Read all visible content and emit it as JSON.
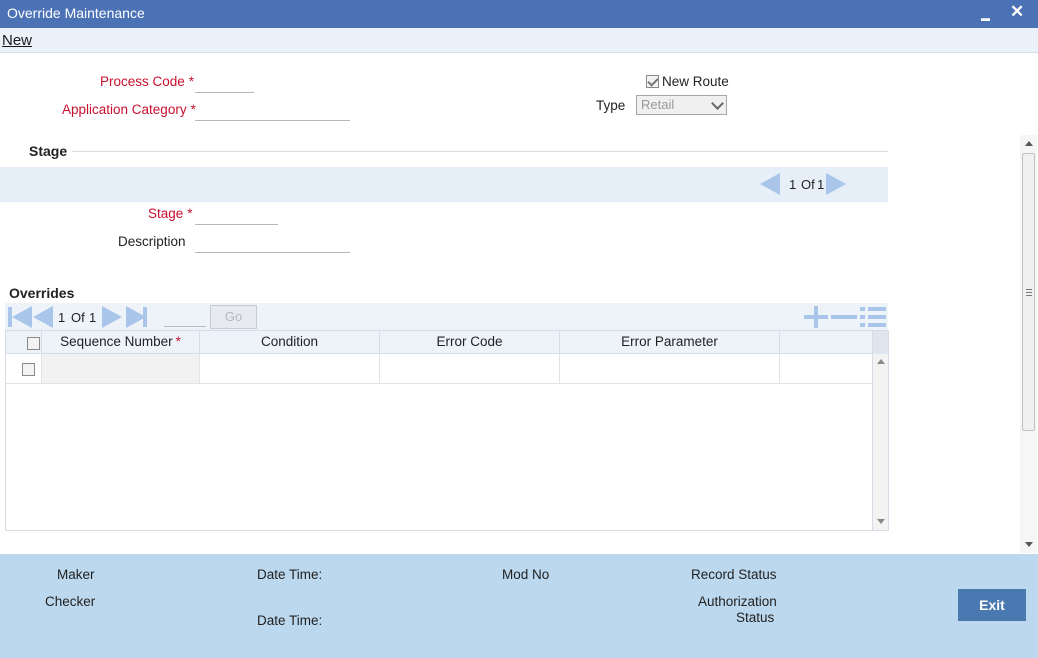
{
  "window": {
    "title": "Override Maintenance",
    "minimize_glyph": "▬",
    "close_glyph": "✕"
  },
  "menu": {
    "new_label": "New"
  },
  "form": {
    "process_code_label": "Process Code",
    "application_category_label": "Application Category",
    "required_marker": "*",
    "new_route_label": "New Route",
    "new_route_checked": true,
    "type_label": "Type",
    "type_value": "Retail"
  },
  "stage": {
    "section_title": "Stage",
    "pager_current": "1",
    "pager_of": "Of",
    "pager_total": "1",
    "stage_label": "Stage",
    "description_label": "Description"
  },
  "overrides": {
    "section_title": "Overrides",
    "pager_current": "1",
    "pager_of": "Of",
    "pager_total": "1",
    "go_label": "Go",
    "columns": [
      "Sequence Number",
      "Condition",
      "Error Code",
      "Error Parameter"
    ],
    "sequence_required_marker": "*"
  },
  "footer": {
    "maker_label": "Maker",
    "checker_label": "Checker",
    "date_time_label_1": "Date Time:",
    "date_time_label_2": "Date Time:",
    "mod_no_label": "Mod No",
    "record_status_label": "Record Status",
    "authorization_label_1": "Authorization",
    "authorization_label_2": "Status",
    "exit_label": "Exit"
  },
  "colors": {
    "titlebar": "#4a72b5",
    "required_label": "#c8102e",
    "footer_bg": "#bcd8ee",
    "exit_button": "#4a78b0",
    "nav_arrow": "#a9c5ea"
  }
}
